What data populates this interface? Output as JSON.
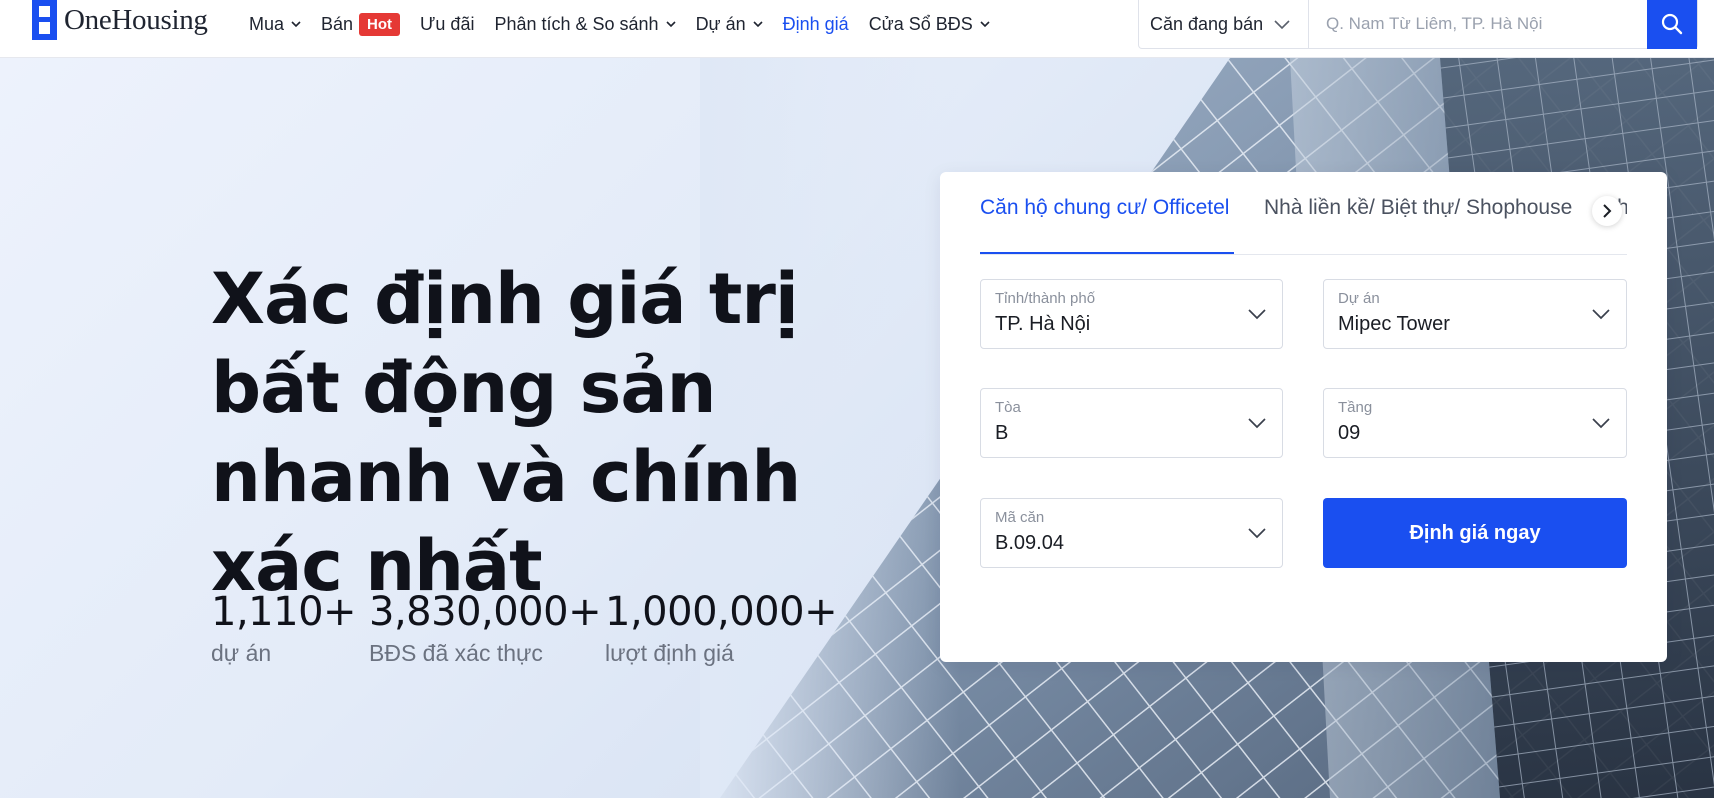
{
  "brand": {
    "name": "OneHousing",
    "accent": "#1a4ff0",
    "hot_color": "#e53935"
  },
  "nav": {
    "items": [
      {
        "label": "Mua",
        "has_dropdown": true
      },
      {
        "label": "Bán",
        "badge": "Hot"
      },
      {
        "label": "Ưu đãi"
      },
      {
        "label": "Phân tích & So sánh",
        "has_dropdown": true
      },
      {
        "label": "Dự án",
        "has_dropdown": true
      },
      {
        "label": "Định giá",
        "active": true
      },
      {
        "label": "Cửa Sổ BĐS",
        "has_dropdown": true
      }
    ]
  },
  "search": {
    "type_value": "Căn đang bán",
    "placeholder": "Q. Nam Từ Liêm, TP. Hà Nội",
    "button_icon": "search-icon"
  },
  "hero": {
    "title": "Xác định giá trị bất động sản nhanh và chính xác nhất",
    "stats": [
      {
        "value": "1,110+",
        "label": "dự án"
      },
      {
        "value": "3,830,000+",
        "label": "BĐS đã xác thực"
      },
      {
        "value": "1,000,000+",
        "label": "lượt định giá"
      }
    ]
  },
  "valuation": {
    "tabs": [
      {
        "label": "Căn hộ chung cư/ Officetel",
        "active": true
      },
      {
        "label": "Nhà liền kề/ Biệt thự/ Shophouse"
      },
      {
        "label": "Nh"
      }
    ],
    "next_icon": "chevron-right-icon",
    "fields": {
      "province": {
        "label": "Tỉnh/thành phố",
        "value": "TP. Hà Nội"
      },
      "project": {
        "label": "Dự án",
        "value": "Mipec Tower"
      },
      "building": {
        "label": "Tòa",
        "value": "B"
      },
      "floor": {
        "label": "Tầng",
        "value": "09"
      },
      "unit": {
        "label": "Mã căn",
        "value": "B.09.04"
      }
    },
    "submit_label": "Định giá ngay"
  }
}
